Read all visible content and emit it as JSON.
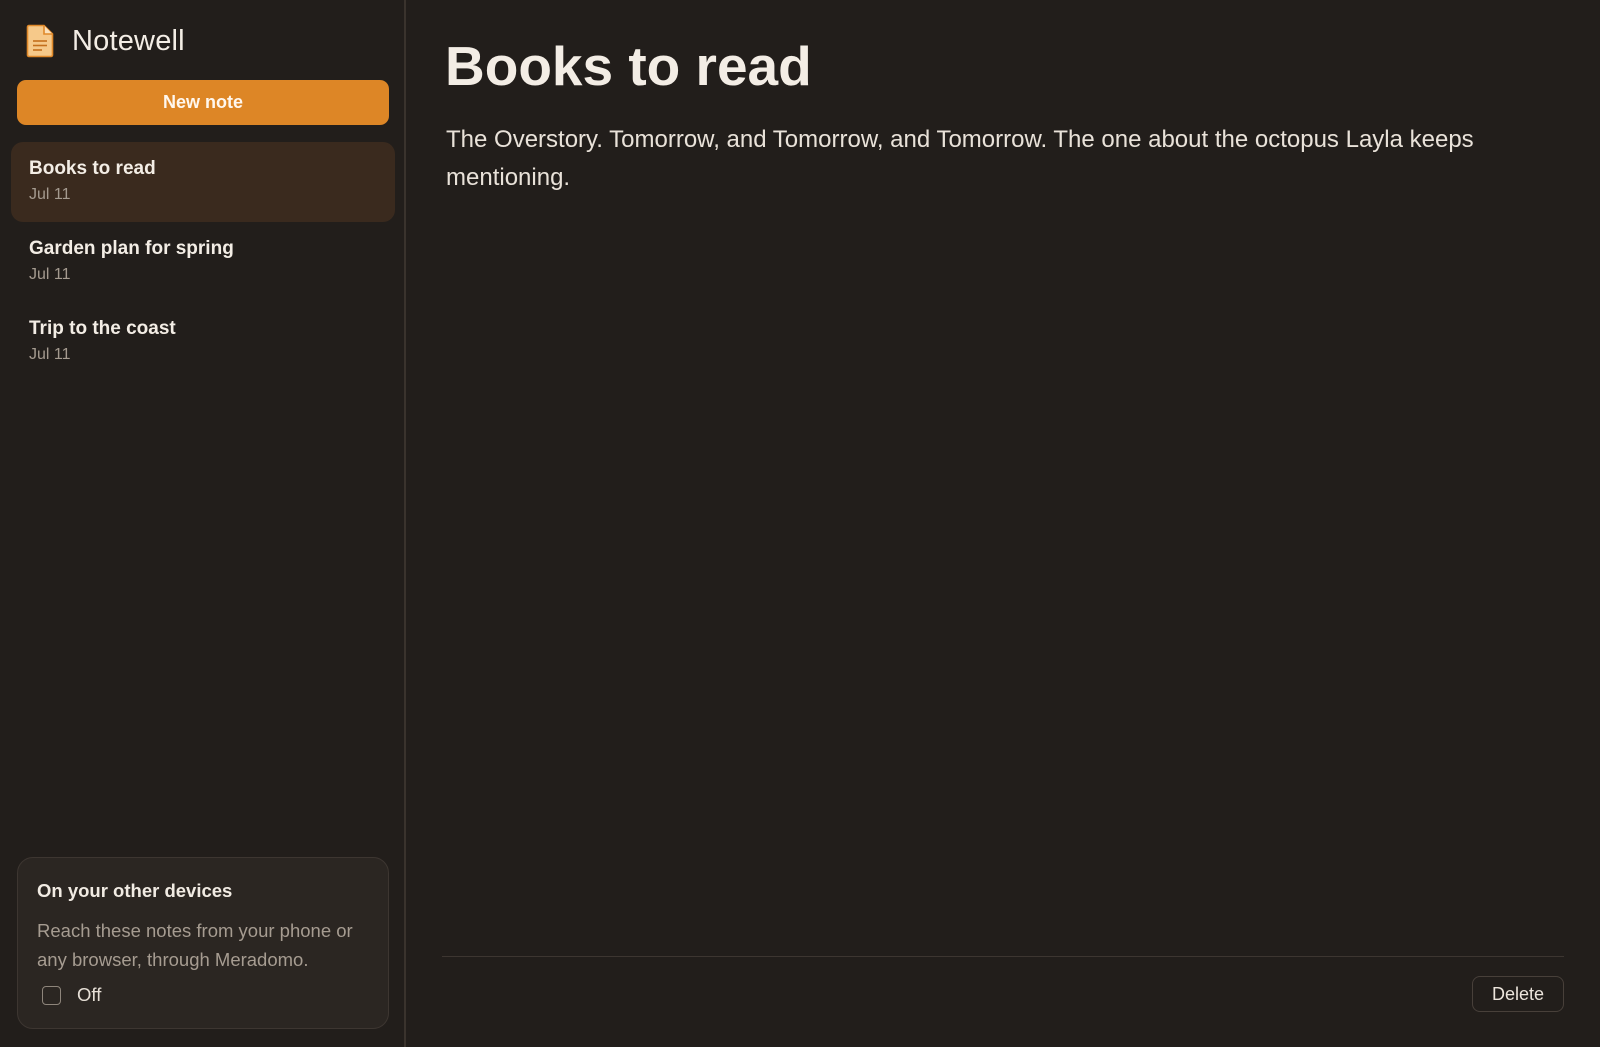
{
  "app": {
    "name": "Notewell",
    "icon": "document-icon",
    "accent_color": "#dd8626"
  },
  "sidebar": {
    "new_note_label": "New note",
    "notes": [
      {
        "title": "Books to read",
        "date": "Jul 11",
        "active": true
      },
      {
        "title": "Garden plan for spring",
        "date": "Jul 11",
        "active": false
      },
      {
        "title": "Trip to the coast",
        "date": "Jul 11",
        "active": false
      }
    ],
    "devices_card": {
      "title": "On your other devices",
      "description": "Reach these notes from your phone or any browser, through Meradomo.",
      "toggle_label": "Off",
      "checked": false
    }
  },
  "main": {
    "title": "Books to read",
    "body": "The Overstory. Tomorrow, and Tomorrow, and Tomorrow. The one about the octopus Layla keeps mentioning.",
    "delete_label": "Delete"
  }
}
